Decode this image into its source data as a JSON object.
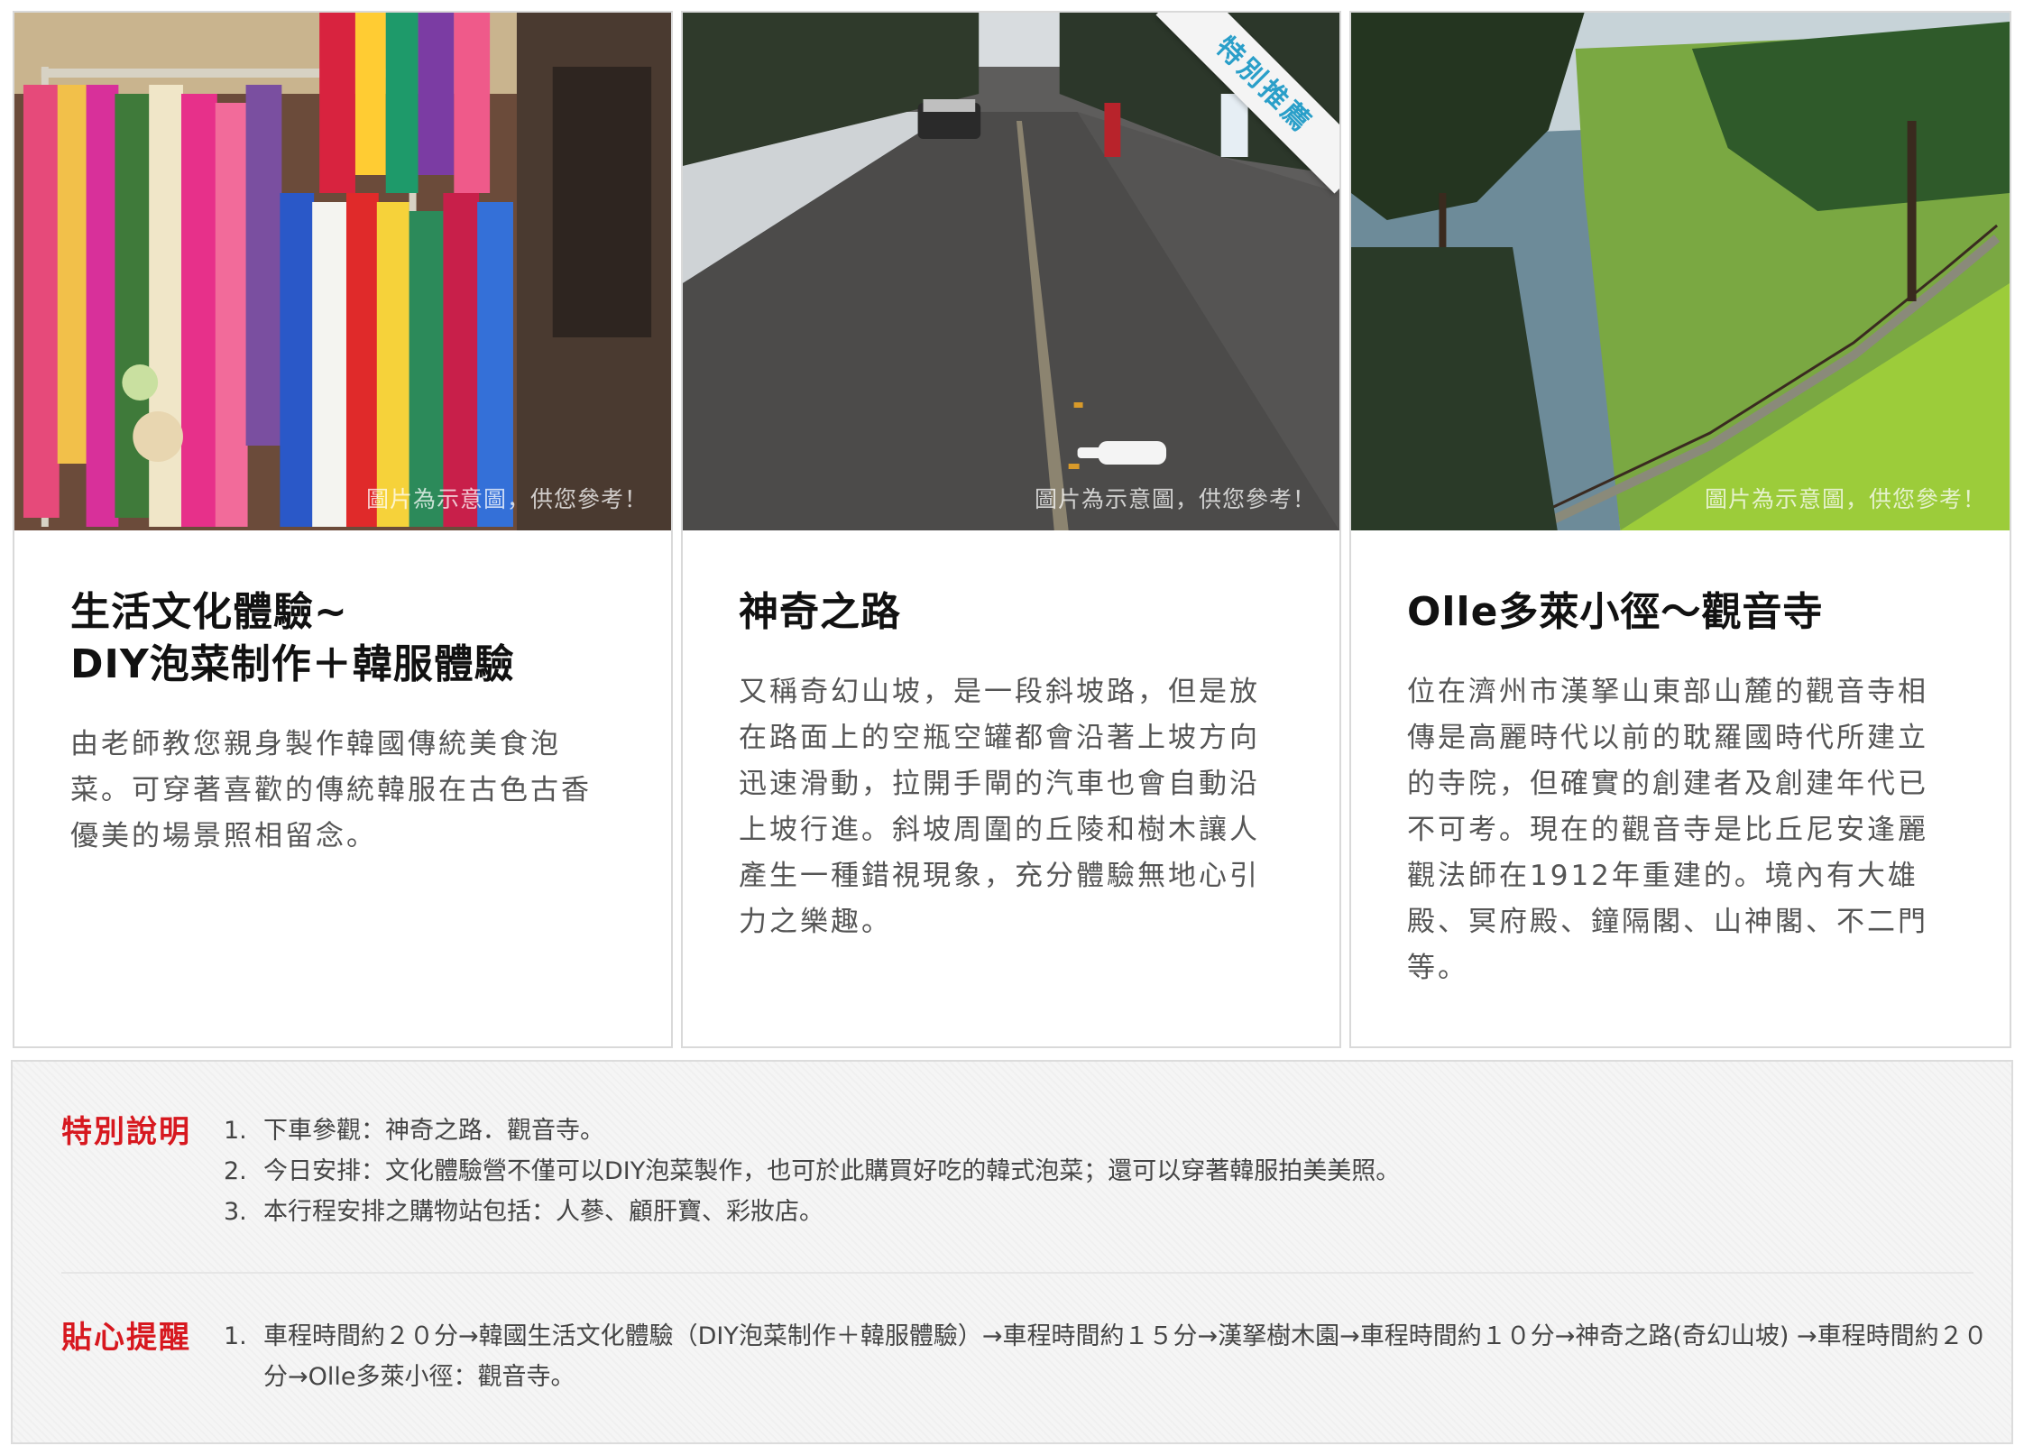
{
  "cards": [
    {
      "photo_note": "圖片為示意圖，供您參考！",
      "title_line1": "生活文化體驗~",
      "title_line2": "DIY泡菜制作＋韓服體驗",
      "description": "由老師教您親身製作韓國傳統美食泡菜。可穿著喜歡的傳統韓服在古色古香優美的場景照相留念。"
    },
    {
      "photo_note": "圖片為示意圖，供您參考！",
      "ribbon": "特別推薦",
      "title": "神奇之路",
      "description": "又稱奇幻山坡，是一段斜坡路，但是放在路面上的空瓶空罐都會沿著上坡方向迅速滑動，拉開手閘的汽車也會自動沿上坡行進。斜坡周圍的丘陵和樹木讓人產生一種錯視現象，充分體驗無地心引力之樂趣。"
    },
    {
      "photo_note": "圖片為示意圖，供您參考！",
      "title": "Olle多萊小徑～觀音寺",
      "description": "位在濟州市漢拏山東部山麓的觀音寺相傳是高麗時代以前的耽羅國時代所建立的寺院，但確實的創建者及創建年代已不可考。現在的觀音寺是比丘尼安逢麗觀法師在1912年重建的。境內有大雄殿、冥府殿、鐘隔閣、山神閣、不二門等。"
    }
  ],
  "special_notes": {
    "heading": "特別說明",
    "items": [
      {
        "num": "1.",
        "text": "下車參觀：神奇之路．觀音寺。"
      },
      {
        "num": "2.",
        "text": "今日安排：文化體驗營不僅可以DIY泡菜製作，也可於此購買好吃的韓式泡菜；還可以穿著韓服拍美美照。"
      },
      {
        "num": "3.",
        "text": "本行程安排之購物站包括：人蔘、顧肝寶、彩妝店。"
      }
    ]
  },
  "reminders": {
    "heading": "貼心提醒",
    "items": [
      {
        "num": "1.",
        "text": "車程時間約２０分→韓國生活文化體驗（DIY泡菜制作＋韓服體驗）→車程時間約１５分→漢拏樹木園→車程時間約１０分→神奇之路(奇幻山坡) →車程時間約２０分→Olle多萊小徑：觀音寺。"
      }
    ]
  },
  "colors": {
    "heading_red": "#d7181f",
    "ribbon_text": "#2a9fc9",
    "card_border": "#d9d9d9"
  }
}
